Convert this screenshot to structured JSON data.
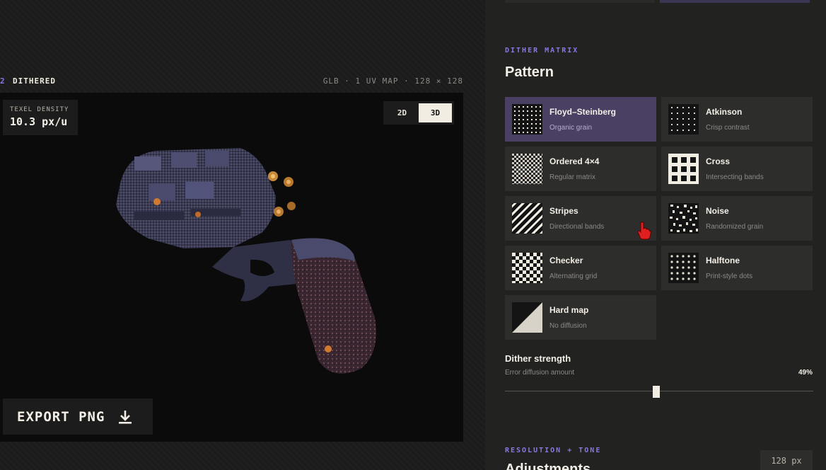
{
  "stage": {
    "index": "2",
    "title": "DITHERED",
    "meta": "GLB · 1 UV MAP · 128 × 128",
    "texel_label": "TEXEL DENSITY",
    "texel_value": "10.3 px/u",
    "view_toggle": [
      "2D",
      "3D"
    ],
    "active_view": "3D",
    "export_label": "EXPORT PNG"
  },
  "panel": {
    "matrix_kicker": "DITHER MATRIX",
    "matrix_title": "Pattern",
    "patterns": [
      {
        "name": "Floyd–Steinberg",
        "desc": "Organic grain",
        "icon": "dot-grid-fine-icon",
        "selected": true
      },
      {
        "name": "Atkinson",
        "desc": "Crisp contrast",
        "icon": "dot-grid-sparse-icon",
        "selected": false
      },
      {
        "name": "Ordered 4×4",
        "desc": "Regular matrix",
        "icon": "fine-checker-icon",
        "selected": false
      },
      {
        "name": "Cross",
        "desc": "Intersecting bands",
        "icon": "cross-grid-icon",
        "selected": false
      },
      {
        "name": "Stripes",
        "desc": "Directional bands",
        "icon": "diagonal-stripes-icon",
        "selected": false
      },
      {
        "name": "Noise",
        "desc": "Randomized grain",
        "icon": "noise-icon",
        "selected": false
      },
      {
        "name": "Checker",
        "desc": "Alternating grid",
        "icon": "checkerboard-icon",
        "selected": false
      },
      {
        "name": "Halftone",
        "desc": "Print-style dots",
        "icon": "halftone-dots-icon",
        "selected": false
      },
      {
        "name": "Hard map",
        "desc": "No diffusion",
        "icon": "hard-map-icon",
        "selected": false
      }
    ],
    "strength_title": "Dither strength",
    "strength_sub": "Error diffusion amount",
    "strength_value_label": "49%",
    "strength_value": 0.49,
    "resolution_kicker": "RESOLUTION + TONE",
    "resolution_title": "Adjustments",
    "resolution_chip": "128 px"
  },
  "colors": {
    "accent": "#8a76e6",
    "selected_tile": "#4a4064",
    "panel_bg": "#222221",
    "tile_bg": "#2d2d2c",
    "viewport_bg": "#0b0b0b"
  }
}
